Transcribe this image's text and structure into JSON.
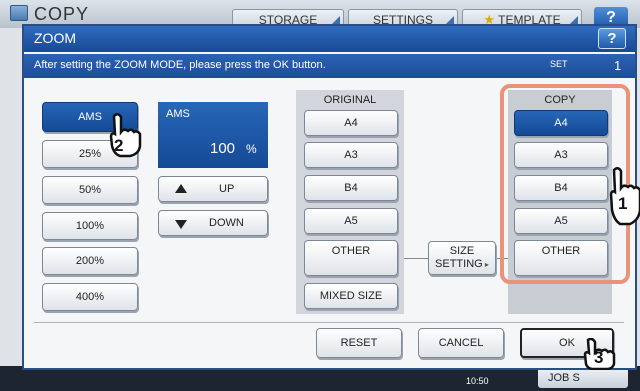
{
  "app": {
    "title": "COPY"
  },
  "top_bar": {
    "storage": "STORAGE",
    "settings": "SETTINGS",
    "template": "TEMPLATE",
    "help": "?"
  },
  "dialog": {
    "title": "ZOOM",
    "help": "?",
    "message": "After setting the ZOOM MODE, please press the OK button.",
    "set_label": "SET",
    "set_value": "1"
  },
  "zoom_presets": [
    "AMS",
    "25%",
    "50%",
    "100%",
    "200%",
    "400%"
  ],
  "ams_display": {
    "label": "AMS",
    "value": "100",
    "unit": "%"
  },
  "adjust": {
    "up": "UP",
    "down": "DOWN"
  },
  "original": {
    "header": "ORIGINAL",
    "sizes": [
      "A4",
      "A3",
      "B4",
      "A5",
      "OTHER"
    ],
    "mixed": "MIXED SIZE"
  },
  "size_setting": {
    "line1": "SIZE",
    "line2": "SETTING"
  },
  "copy": {
    "header": "COPY",
    "sizes": [
      "A4",
      "A3",
      "B4",
      "A5",
      "OTHER"
    ],
    "selected": "A4"
  },
  "footer": {
    "reset": "RESET",
    "cancel": "CANCEL",
    "ok": "OK"
  },
  "status": {
    "time": "10:50",
    "job": "JOB S"
  },
  "callouts": [
    "1",
    "2",
    "3"
  ],
  "colors": {
    "accent": "#1d55a6",
    "highlight": "#e9937a"
  }
}
